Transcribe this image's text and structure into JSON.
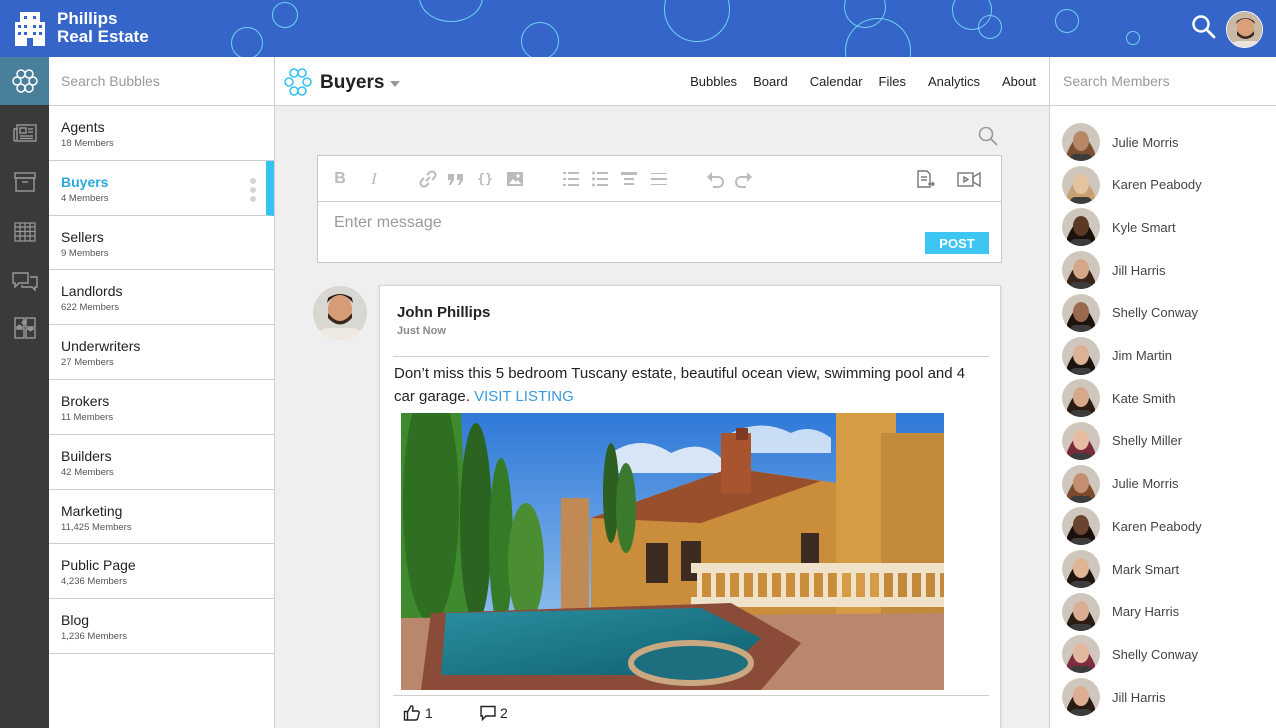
{
  "brand": {
    "name_line1": "Phillips",
    "name_line2": "Real Estate"
  },
  "sidebar_search": {
    "placeholder": "Search Bubbles"
  },
  "rail": {
    "items": [
      "bubbles-icon",
      "newsfeed-icon",
      "archive-icon",
      "calendar-grid-icon",
      "chat-icon",
      "puzzle-icon"
    ]
  },
  "bubbles": [
    {
      "name": "Agents",
      "count": "18 Members"
    },
    {
      "name": "Buyers",
      "count": "4 Members",
      "active": true
    },
    {
      "name": "Sellers",
      "count": "9 Members"
    },
    {
      "name": "Landlords",
      "count": "622 Members"
    },
    {
      "name": "Underwriters",
      "count": "27 Members"
    },
    {
      "name": "Brokers",
      "count": "11 Members"
    },
    {
      "name": "Builders",
      "count": "42 Members"
    },
    {
      "name": "Marketing",
      "count": "11,425 Members"
    },
    {
      "name": "Public Page",
      "count": "4,236 Members"
    },
    {
      "name": "Blog",
      "count": "1,236 Members"
    }
  ],
  "header": {
    "title": "Buyers",
    "nav": [
      "Bubbles",
      "Board",
      "Calendar",
      "Files",
      "Analytics",
      "About"
    ]
  },
  "editor": {
    "placeholder": "Enter message",
    "post_label": "POST"
  },
  "post": {
    "author": "John Phillips",
    "time": "Just Now",
    "text": "Don’t miss this 5 bedroom Tuscany estate, beautiful ocean view, swimming pool and 4 car garage.",
    "link": "VISIT LISTING",
    "likes": "1",
    "comments": "2"
  },
  "members_search": {
    "placeholder": "Search Members"
  },
  "members": [
    "Julie Morris",
    "Karen Peabody",
    "Kyle Smart",
    "Jill Harris",
    "Shelly Conway",
    "Jim Martin",
    "Kate Smith",
    "Shelly Miller",
    "Julie Morris",
    "Karen Peabody",
    "Mark Smart",
    "Mary Harris",
    "Shelly Conway",
    "Jill Harris"
  ],
  "colors": {
    "topbar": "#3565c8",
    "rail": "#3a3a3a",
    "accent": "#36c3f1",
    "link": "#3a98e0"
  }
}
